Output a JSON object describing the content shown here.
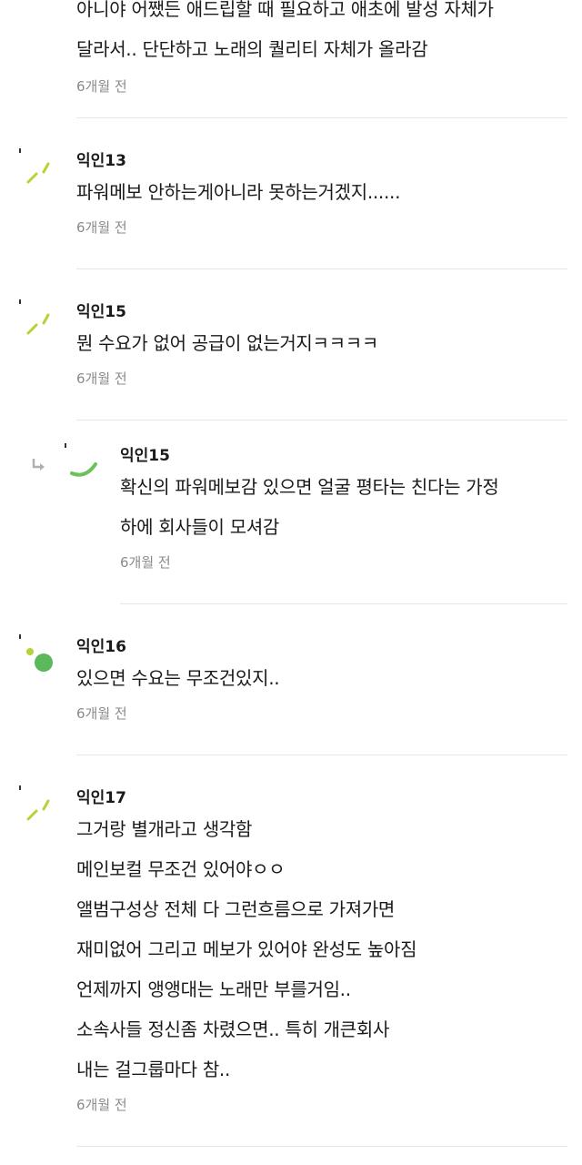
{
  "comments": [
    {
      "author": "",
      "text": "아니야 어쨌든 애드립할 때 필요하고 애초에 발성 자체가\n달라서.. 단단하고 노래의 퀄리티 자체가 올라감",
      "time": "6개월 전",
      "avatar": "none"
    },
    {
      "author": "익인13",
      "text": "파워메보 안하는게아니라 못하는거겠지......",
      "time": "6개월 전",
      "avatar": "sprout-icon"
    },
    {
      "author": "익인15",
      "text": "뭔 수요가 없어 공급이 없는거지ㅋㅋㅋㅋ",
      "time": "6개월 전",
      "avatar": "sprout-icon"
    },
    {
      "author": "익인15",
      "text": "확신의 파워메보감 있으면 얼굴 평타는 친다는 가정\n하에 회사들이 모셔감",
      "time": "6개월 전",
      "avatar": "arc-icon",
      "is_reply": true
    },
    {
      "author": "익인16",
      "text": "있으면 수요는 무조건있지..",
      "time": "6개월 전",
      "avatar": "circle-icon"
    },
    {
      "author": "익인17",
      "text": "그거랑 별개라고 생각함\n메인보컬 무조건 있어야ㅇㅇ\n앨범구성상 전체 다 그런흐름으로 가져가면\n재미없어 그리고 메보가 있어야 완성도 높아짐\n언제까지 앵앵대는 노래만 부를거임..\n소속사들 정신좀 차렸으면.. 특히 개큰회사\n내는 걸그룹마다 참..",
      "time": "6개월 전",
      "avatar": "sprout-icon"
    }
  ],
  "colors": {
    "sprout": "#b5d334",
    "circle": "#5cb85c",
    "arc": "#6bc25a"
  }
}
